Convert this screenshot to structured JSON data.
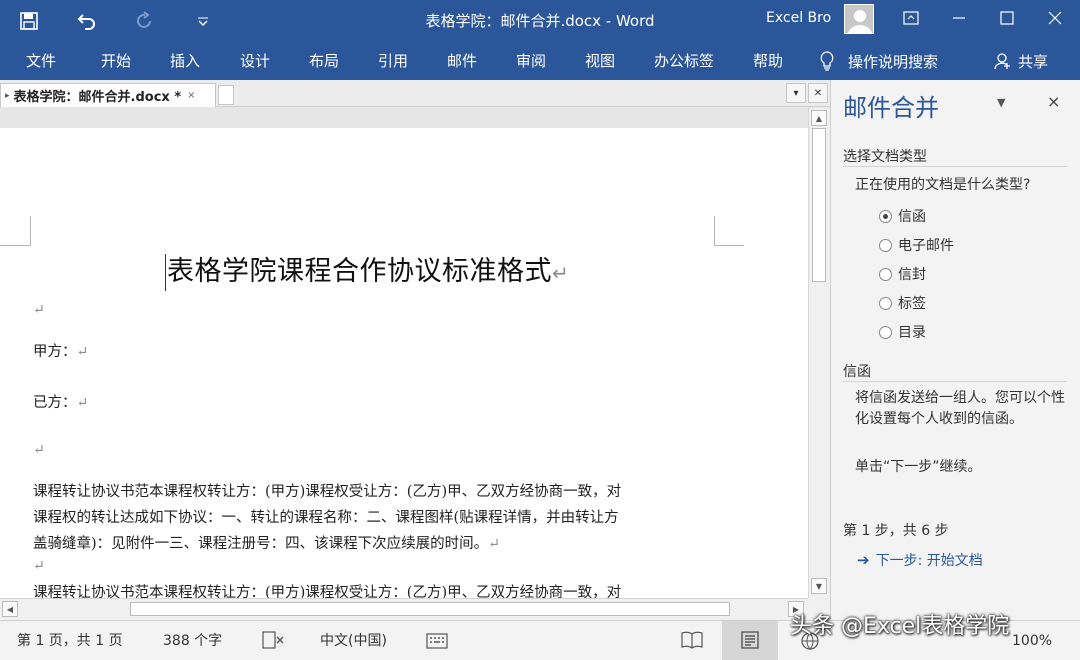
{
  "title_bar": {
    "document_title": "表格学院：邮件合并.docx  -  Word",
    "user_name": "Excel Bro"
  },
  "ribbon_tabs": [
    "文件",
    "开始",
    "插入",
    "设计",
    "布局",
    "引用",
    "邮件",
    "审阅",
    "视图",
    "办公标签",
    "帮助"
  ],
  "tell_me": "操作说明搜索",
  "share": "共享",
  "document_tab": {
    "name": "表格学院：邮件合并.docx *",
    "close": "×"
  },
  "document": {
    "heading": "表格学院课程合作协议标准格式",
    "mark": "↵",
    "party_a": "甲方：",
    "party_b": "已方：",
    "paragraph1": "课程转让协议书范本课程权转让方：(甲方)课程权受让方：(乙方)甲、乙双方经协商一致，对\n课程权的转让达成如下协议：一、转让的课程名称：二、课程图样(贴课程详情，并由转让方\n盖骑缝章)：见附件一三、课程注册号：四、该课程下次应续展的时间。",
    "paragraph2": "课程转让协议书范本课程权转让方：(甲方)课程权受让方：(乙方)甲、乙双方经协商一致，对"
  },
  "task_pane": {
    "title": "邮件合并",
    "close": "×",
    "section1_heading": "选择文档类型",
    "question": "正在使用的文档是什么类型?",
    "options": [
      {
        "label": "信函",
        "selected": true
      },
      {
        "label": "电子邮件",
        "selected": false
      },
      {
        "label": "信封",
        "selected": false
      },
      {
        "label": "标签",
        "selected": false
      },
      {
        "label": "目录",
        "selected": false
      }
    ],
    "section2_heading": "信函",
    "description": "将信函发送给一组人。您可以个性化设置每个人收到的信函。",
    "hint": "单击“下一步”继续。",
    "step": "第 1 步，共 6 步",
    "next_link": "下一步: 开始文档"
  },
  "status_bar": {
    "page": "第 1 页，共 1 页",
    "word_count": "388 个字",
    "language": "中文(中国)",
    "zoom": "100%"
  },
  "watermark": "头条 @Excel表格学院",
  "colors": {
    "accent": "#2b579a",
    "pane_bg": "#f3f3f3"
  }
}
